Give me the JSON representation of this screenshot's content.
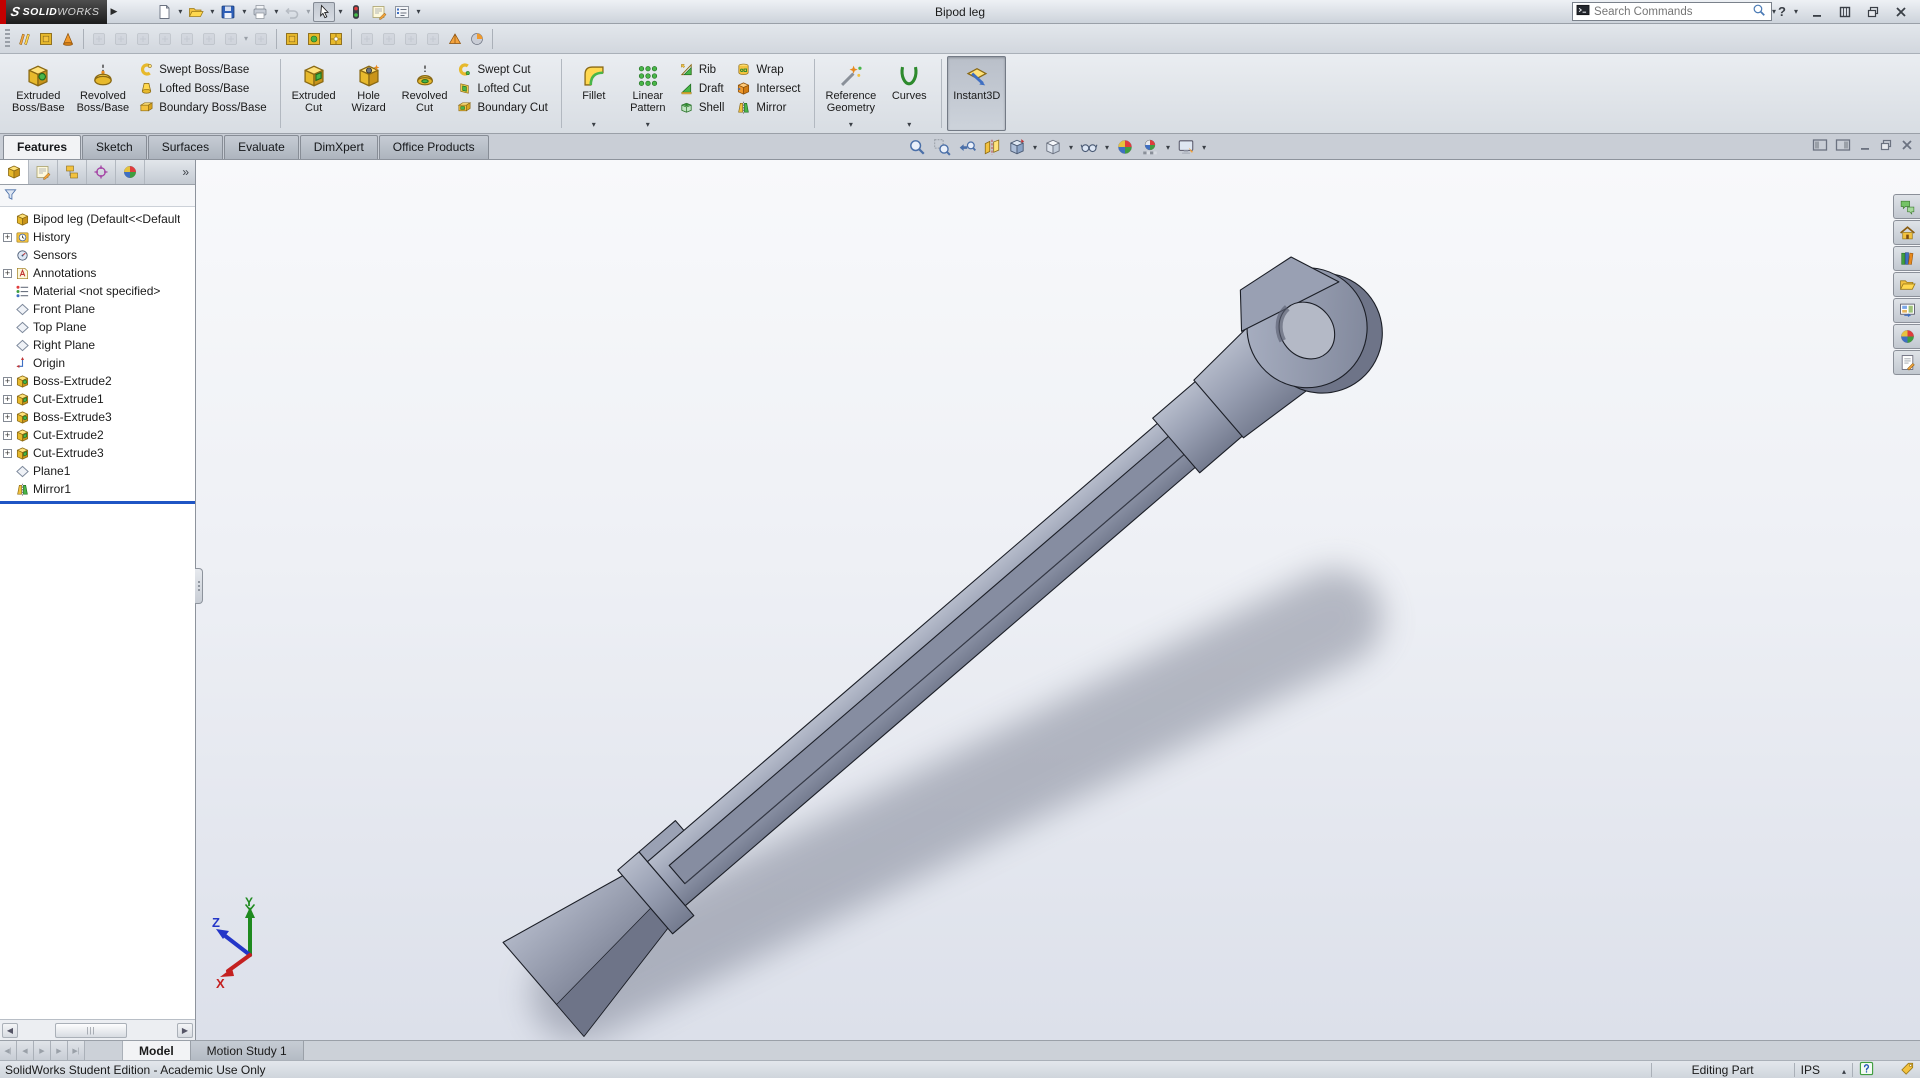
{
  "titlebar": {
    "logo_bold": "SOLID",
    "logo_light": "WORKS",
    "document_title": "Bipod leg",
    "search": {
      "placeholder": "Search Commands",
      "icon": "search-console-icon",
      "glass_icon": "magnifier-icon"
    },
    "tools": [
      {
        "name": "new",
        "icon": "new-doc",
        "caret": true
      },
      {
        "name": "open",
        "icon": "open-folder",
        "caret": true
      },
      {
        "name": "save",
        "icon": "save",
        "caret": true
      },
      {
        "name": "print",
        "icon": "print",
        "caret": true
      },
      {
        "name": "undo",
        "icon": "undo",
        "caret": true,
        "disabled": true
      },
      {
        "name": "select",
        "icon": "cursor",
        "caret": true,
        "pressed": true
      },
      {
        "name": "rebuild",
        "icon": "rebuild"
      },
      {
        "name": "file-properties",
        "icon": "file-properties"
      },
      {
        "name": "options",
        "icon": "options-list",
        "caret": true
      }
    ],
    "window_buttons": [
      "help",
      "minimize",
      "maximize",
      "restore",
      "close"
    ]
  },
  "toolbar2": [
    {
      "name": "sketch-tool-1",
      "icon": "sketch-tool"
    },
    {
      "name": "sketch-tool-2",
      "icon": "view-gold"
    },
    {
      "name": "sketch-tool-3",
      "icon": "cone-tool"
    },
    {
      "name": "sep"
    },
    {
      "name": "feature-tool-1",
      "icon": "gray",
      "disabled": true
    },
    {
      "name": "feature-tool-2",
      "icon": "gray",
      "disabled": true
    },
    {
      "name": "feature-tool-3",
      "icon": "gray",
      "disabled": true
    },
    {
      "name": "feature-tool-4",
      "icon": "gray",
      "disabled": true
    },
    {
      "name": "feature-tool-5",
      "icon": "gray",
      "disabled": true
    },
    {
      "name": "feature-tool-6",
      "icon": "gray",
      "disabled": true
    },
    {
      "name": "feature-tool-7",
      "icon": "gray",
      "disabled": true,
      "caret": true
    },
    {
      "name": "anchor-tool",
      "icon": "gray",
      "disabled": true
    },
    {
      "name": "sep"
    },
    {
      "name": "view-single",
      "icon": "view-gold"
    },
    {
      "name": "view-two",
      "icon": "view-gold2"
    },
    {
      "name": "view-four",
      "icon": "view-gold3"
    },
    {
      "name": "sep"
    },
    {
      "name": "insert-down",
      "icon": "gray",
      "disabled": true
    },
    {
      "name": "insert-up",
      "icon": "gray",
      "disabled": true
    },
    {
      "name": "window-tool",
      "icon": "gray",
      "disabled": true
    },
    {
      "name": "no-preview",
      "icon": "gray",
      "disabled": true
    },
    {
      "name": "section-tool",
      "icon": "wedge-tool"
    },
    {
      "name": "render-tool",
      "icon": "render-ball"
    },
    {
      "name": "sep"
    }
  ],
  "ribbon": {
    "groups": [
      {
        "cols": [
          {
            "t": "big",
            "icon": "extruded-boss",
            "label": "Extruded\nBoss/Base"
          },
          {
            "t": "big",
            "icon": "revolved-boss",
            "label": "Revolved\nBoss/Base"
          },
          {
            "t": "stack",
            "items": [
              {
                "icon": "swept-boss",
                "label": "Swept Boss/Base"
              },
              {
                "icon": "lofted-boss",
                "label": "Lofted Boss/Base"
              },
              {
                "icon": "boundary-boss",
                "label": "Boundary Boss/Base"
              }
            ]
          }
        ]
      },
      {
        "cols": [
          {
            "t": "big",
            "icon": "extruded-cut",
            "label": "Extruded\nCut"
          },
          {
            "t": "big",
            "icon": "hole-wizard",
            "label": "Hole\nWizard"
          },
          {
            "t": "big",
            "icon": "revolved-cut",
            "label": "Revolved\nCut"
          },
          {
            "t": "stack",
            "items": [
              {
                "icon": "swept-cut",
                "label": "Swept Cut"
              },
              {
                "icon": "lofted-cut",
                "label": "Lofted Cut"
              },
              {
                "icon": "boundary-cut",
                "label": "Boundary Cut"
              }
            ]
          }
        ]
      },
      {
        "cols": [
          {
            "t": "big",
            "icon": "fillet",
            "label": "Fillet",
            "caret": true
          },
          {
            "t": "big",
            "icon": "linear-pattern",
            "label": "Linear\nPattern",
            "caret": true
          },
          {
            "t": "stack",
            "items": [
              {
                "icon": "rib",
                "label": "Rib"
              },
              {
                "icon": "draft",
                "label": "Draft"
              },
              {
                "icon": "shell",
                "label": "Shell"
              }
            ]
          },
          {
            "t": "stack",
            "items": [
              {
                "icon": "wrap",
                "label": "Wrap"
              },
              {
                "icon": "intersect",
                "label": "Intersect"
              },
              {
                "icon": "mirror",
                "label": "Mirror"
              }
            ]
          }
        ]
      },
      {
        "cols": [
          {
            "t": "big",
            "icon": "reference-geometry",
            "label": "Reference\nGeometry",
            "caret": true
          },
          {
            "t": "big",
            "icon": "curves",
            "label": "Curves",
            "caret": true
          }
        ]
      },
      {
        "cols": [
          {
            "t": "big",
            "icon": "instant3d",
            "label": "Instant3D",
            "pressed": true
          }
        ]
      }
    ]
  },
  "command_tabs": [
    {
      "label": "Features",
      "active": true
    },
    {
      "label": "Sketch"
    },
    {
      "label": "Surfaces"
    },
    {
      "label": "Evaluate"
    },
    {
      "label": "DimXpert"
    },
    {
      "label": "Office Products"
    }
  ],
  "hud": [
    {
      "name": "zoom-to-fit",
      "icon": "zoom-fit"
    },
    {
      "name": "zoom-to-area",
      "icon": "zoom-area"
    },
    {
      "name": "previous-view",
      "icon": "previous-view"
    },
    {
      "name": "section-view",
      "icon": "section-view"
    },
    {
      "name": "view-orientation",
      "icon": "view-orientation",
      "caret": true
    },
    {
      "name": "display-style",
      "icon": "display-style",
      "caret": true
    },
    {
      "name": "hide-show-items",
      "icon": "hide-show",
      "caret": true
    },
    {
      "name": "edit-appearance",
      "icon": "edit-appearance"
    },
    {
      "name": "apply-scene",
      "icon": "apply-scene",
      "caret": true
    },
    {
      "name": "view-settings",
      "icon": "view-settings",
      "caret": true
    }
  ],
  "manager_tabs": [
    {
      "name": "featuremanager",
      "icon": "featmgr",
      "active": true
    },
    {
      "name": "propertymanager",
      "icon": "file-properties"
    },
    {
      "name": "configurationmanager",
      "icon": "configmgr"
    },
    {
      "name": "dimxpertmanager",
      "icon": "dimxpert"
    },
    {
      "name": "displaymanager",
      "icon": "edit-appearance"
    }
  ],
  "manager_more": "»",
  "tree": [
    {
      "icon": "part",
      "label": "Bipod leg (Default<<Default",
      "root": true
    },
    {
      "icon": "history",
      "label": "History",
      "plus": true
    },
    {
      "icon": "sensors",
      "label": "Sensors"
    },
    {
      "icon": "annotations",
      "label": "Annotations",
      "plus": true
    },
    {
      "icon": "material",
      "label": "Material <not specified>"
    },
    {
      "icon": "plane",
      "label": "Front Plane"
    },
    {
      "icon": "plane",
      "label": "Top Plane"
    },
    {
      "icon": "plane",
      "label": "Right Plane"
    },
    {
      "icon": "origin",
      "label": "Origin"
    },
    {
      "icon": "boss-extrude",
      "label": "Boss-Extrude2",
      "plus": true
    },
    {
      "icon": "cut-extrude",
      "label": "Cut-Extrude1",
      "plus": true
    },
    {
      "icon": "boss-extrude",
      "label": "Boss-Extrude3",
      "plus": true
    },
    {
      "icon": "cut-extrude",
      "label": "Cut-Extrude2",
      "plus": true
    },
    {
      "icon": "cut-extrude",
      "label": "Cut-Extrude3",
      "plus": true
    },
    {
      "icon": "plane",
      "label": "Plane1"
    },
    {
      "icon": "mirror",
      "label": "Mirror1"
    }
  ],
  "taskpane": [
    {
      "name": "solidworks-forum",
      "icon": "forum"
    },
    {
      "name": "solidworks-resources",
      "icon": "home"
    },
    {
      "name": "design-library",
      "icon": "design-library"
    },
    {
      "name": "file-explorer",
      "icon": "open-folder"
    },
    {
      "name": "view-palette",
      "icon": "view-palette"
    },
    {
      "name": "appearances-scenes",
      "icon": "edit-appearance"
    },
    {
      "name": "custom-properties",
      "icon": "custom-properties"
    }
  ],
  "viewport": {
    "triad": {
      "x": "X",
      "y": "Y",
      "z": "Z"
    }
  },
  "doc_tabs": [
    {
      "label": "Model",
      "active": true
    },
    {
      "label": "Motion Study 1"
    }
  ],
  "statusbar": {
    "left_text": "SolidWorks Student Edition - Academic Use Only",
    "editing_mode": "Editing Part",
    "units": "IPS"
  },
  "colors": {
    "model_face": "#99a0b3",
    "model_dark": "#6e7488",
    "model_light": "#b6bccb",
    "viewport_top": "#f8f9fb",
    "viewport_bottom": "#dce0ea",
    "rollback_blue": "#1f55c4",
    "logo_red": "#c40000"
  }
}
